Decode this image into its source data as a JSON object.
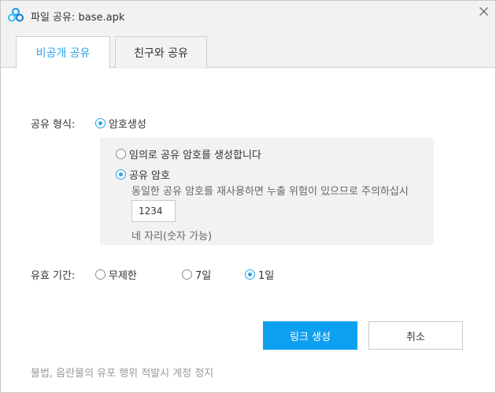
{
  "window": {
    "title": "파일 공유:  base.apk"
  },
  "tabs": [
    {
      "label": "비공개 공유",
      "active": true
    },
    {
      "label": "친구와 공유",
      "active": false
    }
  ],
  "share_format": {
    "label": "공유 형식:",
    "option": "암호생성",
    "selected": true
  },
  "password": {
    "random_option": "임의로 공유 암호를 생성합니다",
    "custom_option": "공유 암호",
    "selected": "custom",
    "warning": "동일한 공유 암호를 재사용하면 누출 위험이 있으므로 주의하십시",
    "value": "1234",
    "hint": "네 자리(숫자 가능)"
  },
  "validity": {
    "label": "유효 기간:",
    "options": [
      "무제한",
      "7일",
      "1일"
    ],
    "selected": "1일"
  },
  "buttons": {
    "create_link": "링크 생성",
    "cancel": "취소"
  },
  "footer_note": "불법, 음란물의 유포 행위 적발시 계정 정지",
  "colors": {
    "accent": "#2aa3ea",
    "primary_button": "#0ea0f0"
  }
}
